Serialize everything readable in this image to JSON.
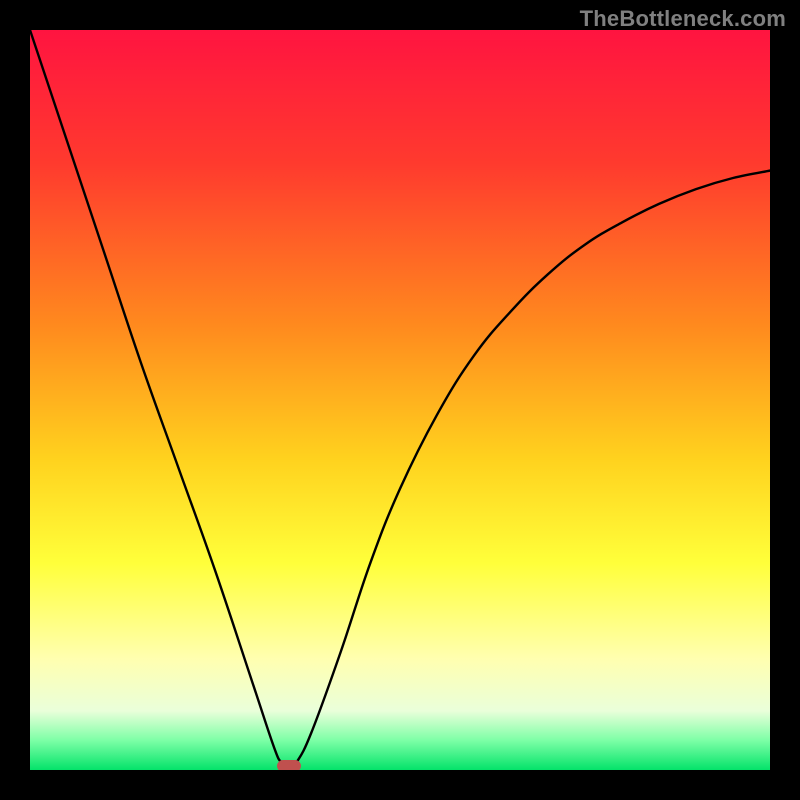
{
  "watermark": "TheBottleneck.com",
  "chart_data": {
    "type": "line",
    "title": "",
    "xlabel": "",
    "ylabel": "",
    "xlim": [
      0,
      100
    ],
    "ylim": [
      0,
      100
    ],
    "grid": false,
    "legend": false,
    "gradient_stops": [
      {
        "pct": 0,
        "color": "#ff1440"
      },
      {
        "pct": 18,
        "color": "#ff3a2e"
      },
      {
        "pct": 40,
        "color": "#ff8a1e"
      },
      {
        "pct": 58,
        "color": "#ffd21e"
      },
      {
        "pct": 72,
        "color": "#ffff3a"
      },
      {
        "pct": 85,
        "color": "#ffffb0"
      },
      {
        "pct": 92,
        "color": "#eaffda"
      },
      {
        "pct": 96,
        "color": "#7dffa6"
      },
      {
        "pct": 100,
        "color": "#04e36a"
      }
    ],
    "series": [
      {
        "name": "bottleneck-curve",
        "x": [
          0,
          5,
          10,
          15,
          20,
          25,
          30,
          33,
          34,
          35,
          36,
          38,
          42,
          46,
          50,
          55,
          60,
          65,
          70,
          75,
          80,
          85,
          90,
          95,
          100
        ],
        "y": [
          100,
          85,
          70,
          55,
          41,
          27,
          12,
          3,
          1,
          0,
          1,
          5,
          16,
          28,
          38,
          48,
          56,
          62,
          67,
          71,
          74,
          76.5,
          78.5,
          80,
          81
        ]
      }
    ],
    "minimum_point": {
      "x": 35,
      "y": 0
    }
  }
}
